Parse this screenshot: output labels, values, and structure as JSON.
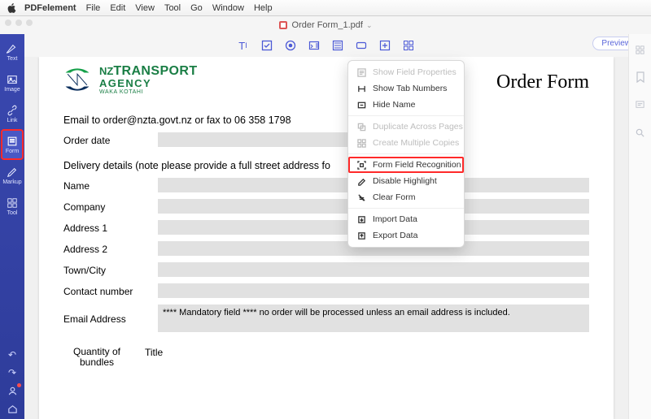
{
  "menubar": {
    "app": "PDFelement",
    "items": [
      "File",
      "Edit",
      "View",
      "Tool",
      "Go",
      "Window",
      "Help"
    ]
  },
  "document_title": "Order Form_1.pdf",
  "preview_label": "Preview",
  "left_sidebar": {
    "items": [
      {
        "label": "Text"
      },
      {
        "label": "Image"
      },
      {
        "label": "Link"
      },
      {
        "label": "Form"
      },
      {
        "label": "Markup"
      },
      {
        "label": "Tool"
      }
    ]
  },
  "page": {
    "logo": {
      "line1_prefix": "NZ",
      "line1": "TRANSPORT",
      "line2": "AGENCY",
      "line3": "WAKA KOTAHI"
    },
    "title": "Order Form",
    "email_line": "Email to order@nzta.govt.nz or fax to 06 358 1798",
    "order_date_label": "Order date",
    "delivery_heading_visible": "Delivery details (note please provide a full street address fo",
    "rows": [
      {
        "label": "Name"
      },
      {
        "label": "Company"
      },
      {
        "label": "Address 1"
      },
      {
        "label": "Address 2"
      },
      {
        "label": "Town/City"
      },
      {
        "label": "Contact number"
      },
      {
        "label": "Email Address"
      }
    ],
    "mandatory_note": "**** Mandatory field **** no order will be processed unless an email address is included.",
    "qty_header": {
      "col1": "Quantity of bundles",
      "col2": "Title"
    }
  },
  "context_menu": {
    "items": [
      {
        "label": "Show Field Properties",
        "disabled": true,
        "icon": "properties-icon"
      },
      {
        "label": "Show Tab Numbers",
        "disabled": false,
        "icon": "tab-numbers-icon"
      },
      {
        "label": "Hide Name",
        "disabled": false,
        "icon": "hide-name-icon"
      },
      {
        "sep": true
      },
      {
        "label": "Duplicate Across Pages",
        "disabled": true,
        "icon": "duplicate-icon"
      },
      {
        "label": "Create Multiple Copies",
        "disabled": true,
        "icon": "copies-icon"
      },
      {
        "sep": true
      },
      {
        "label": "Form Field Recognition",
        "disabled": false,
        "highlight": true,
        "icon": "recognition-icon"
      },
      {
        "label": "Disable Highlight",
        "disabled": false,
        "icon": "highlight-icon"
      },
      {
        "label": "Clear Form",
        "disabled": false,
        "icon": "clear-icon"
      },
      {
        "sep": true
      },
      {
        "label": "Import Data",
        "disabled": false,
        "icon": "import-icon"
      },
      {
        "label": "Export Data",
        "disabled": false,
        "icon": "export-icon"
      }
    ]
  }
}
